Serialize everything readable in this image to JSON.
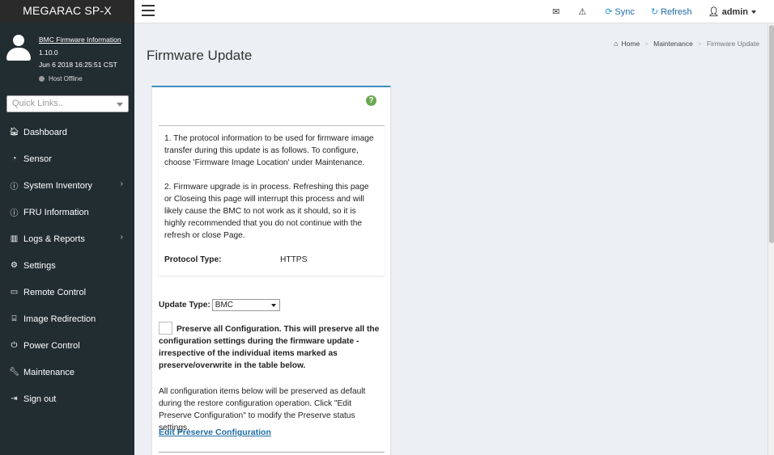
{
  "sidebar": {
    "brand": "MEGARAC SP-X",
    "user": {
      "fw_info_link": "BMC Firmware Information",
      "version": "1.10.0",
      "datetime": "Jun 6 2018 16:25:51 CST",
      "host_status": "Host Offline"
    },
    "quick_links_placeholder": "Quick Links..",
    "items": [
      {
        "label": "Dashboard",
        "icon": "dashboard-icon"
      },
      {
        "label": "Sensor",
        "icon": "sensor-icon"
      },
      {
        "label": "System Inventory",
        "icon": "info-icon"
      },
      {
        "label": "FRU Information",
        "icon": "info-icon"
      },
      {
        "label": "Logs & Reports",
        "icon": "bar-chart-icon"
      },
      {
        "label": "Settings",
        "icon": "gear-icon"
      },
      {
        "label": "Remote Control",
        "icon": "monitor-icon"
      },
      {
        "label": "Image Redirection",
        "icon": "drive-icon"
      },
      {
        "label": "Power Control",
        "icon": "power-icon"
      },
      {
        "label": "Maintenance",
        "icon": "wrench-icon"
      },
      {
        "label": "Sign out",
        "icon": "sign-out-icon"
      }
    ]
  },
  "topnav": {
    "sync_label": "Sync",
    "refresh_label": "Refresh",
    "user_label": "admin"
  },
  "page": {
    "title": "Firmware Update",
    "breadcrumb": {
      "home": "Home",
      "section": "Maintenance",
      "current": "Firmware Update"
    }
  },
  "info": {
    "para1": "1. The protocol information to be used for firmware image transfer during this update is as follows. To configure, choose 'Firmware Image Location' under Maintenance.",
    "para2": "2. Firmware upgrade is in process. Refreshing this page or Closeing this page will interrupt this process and will likely cause the BMC to not work as it should, so it is highly recommended that you do not continue with the refresh or close Page.",
    "protocol_label": "Protocol Type:",
    "protocol_value": "HTTPS"
  },
  "form": {
    "update_type_label": "Update Type:",
    "update_type_value": "BMC",
    "preserve_text": "Preserve all Configuration. This will preserve all the configuration settings during the firmware update - irrespective of the individual items marked as preserve/overwrite in the table below.",
    "note": "All configuration items below will be preserved as default during the restore configuration operation. Click \"Edit Preserve Configuration\" to modify the Preserve status settings.",
    "edit_link": "Edit Preserve Configuration"
  }
}
